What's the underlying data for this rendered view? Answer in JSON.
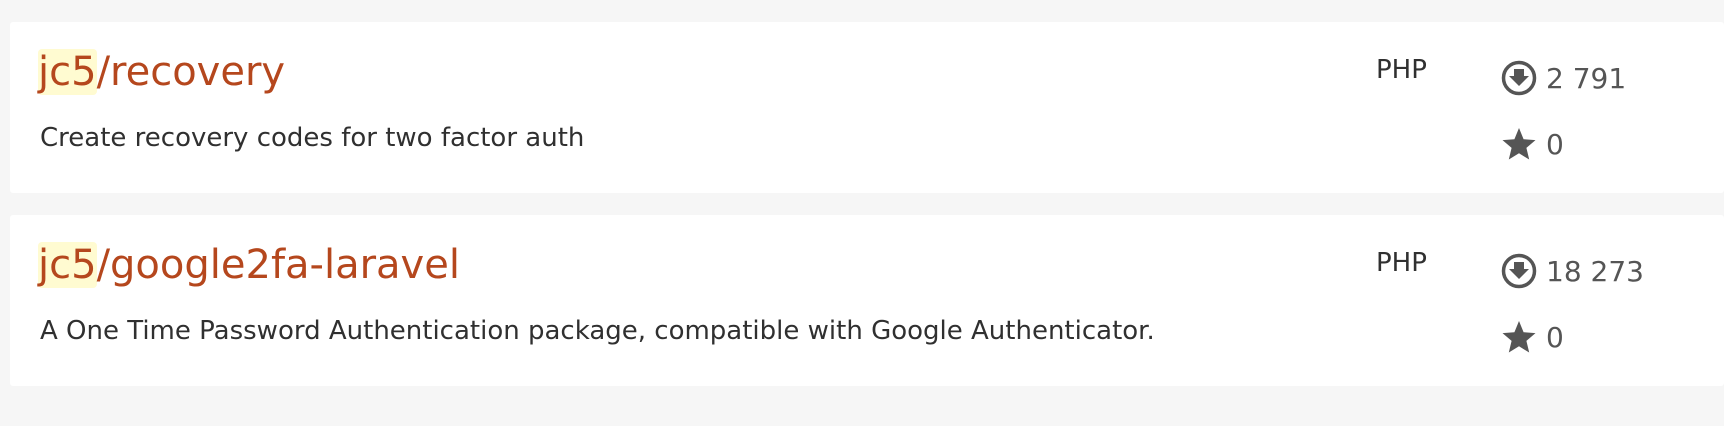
{
  "packages": [
    {
      "vendor": "jc5",
      "name": "/recovery",
      "description": "Create recovery codes for two factor auth",
      "language": "PHP",
      "downloads": "2 791",
      "favers": "0"
    },
    {
      "vendor": "jc5",
      "name": "/google2fa-laravel",
      "description": "A One Time Password Authentication package, compatible with Google Authenticator.",
      "language": "PHP",
      "downloads": "18 273",
      "favers": "0"
    }
  ],
  "icons": {
    "downloads": "download-circle-icon",
    "favers": "star-icon"
  },
  "colors": {
    "link": "#b5471d",
    "vendor_highlight": "#fffbd1",
    "page_background": "#f6f6f6",
    "card_background": "#ffffff",
    "text": "#303030",
    "meta_text": "#555555"
  }
}
